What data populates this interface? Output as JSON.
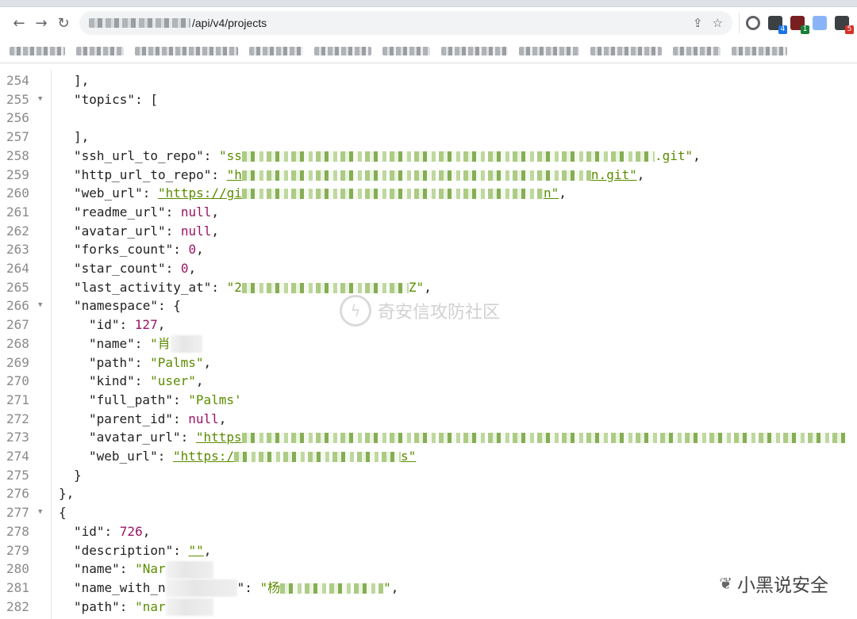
{
  "browser": {
    "url_path": "/api/v4/projects",
    "nav": {
      "back_icon": "←",
      "forward_icon": "→",
      "reload_icon": "↻"
    },
    "actions": {
      "share_icon": "⇪",
      "star_icon": "☆"
    },
    "extensions": [
      {
        "name": "circle-extension-icon",
        "color": "#5f6368",
        "badge": ""
      },
      {
        "name": "extension-icon-1",
        "color": "#3c4043",
        "badge": "4",
        "badge_color": "#1a73e8"
      },
      {
        "name": "extension-icon-2",
        "color": "#7a1f1f",
        "badge": "1",
        "badge_color": "#188038"
      },
      {
        "name": "hourglass-extension-icon",
        "color": "#8ab4f8",
        "badge": ""
      },
      {
        "name": "extension-icon-p",
        "color": "#3c4043",
        "badge": "5",
        "badge_color": "#d93025"
      }
    ]
  },
  "json_view": {
    "lines": [
      {
        "num": "254",
        "indent": 2,
        "text": "],"
      },
      {
        "num": "255",
        "indent": 2,
        "fold": "▼",
        "key": "topics",
        "open": "["
      },
      {
        "num": "256",
        "indent": 2,
        "text": ""
      },
      {
        "num": "257",
        "indent": 2,
        "text": "],"
      },
      {
        "num": "258",
        "indent": 2,
        "key": "ssh_url_to_repo",
        "str_pre": "ss",
        "mask": 520,
        "str_post": ".git",
        "trail": ","
      },
      {
        "num": "259",
        "indent": 2,
        "key": "http_url_to_repo",
        "url_pre": "h",
        "mask": 440,
        "url_post": "n.git",
        "trail": ","
      },
      {
        "num": "260",
        "indent": 2,
        "key": "web_url",
        "url_pre": "https://gi",
        "mask": 380,
        "url_post": "n",
        "trail": ","
      },
      {
        "num": "261",
        "indent": 2,
        "key": "readme_url",
        "null": "null",
        "trail": ","
      },
      {
        "num": "262",
        "indent": 2,
        "key": "avatar_url",
        "null": "null",
        "trail": ","
      },
      {
        "num": "263",
        "indent": 2,
        "key": "forks_count",
        "numval": "0",
        "trail": ","
      },
      {
        "num": "264",
        "indent": 2,
        "key": "star_count",
        "numval": "0",
        "trail": ","
      },
      {
        "num": "265",
        "indent": 2,
        "key": "last_activity_at",
        "str_pre": "2",
        "mask": 210,
        "str_post": "Z",
        "trail": ","
      },
      {
        "num": "266",
        "indent": 2,
        "fold": "▼",
        "key": "namespace",
        "open": "{"
      },
      {
        "num": "267",
        "indent": 3,
        "key": "id",
        "numval": "127",
        "trail": ","
      },
      {
        "num": "268",
        "indent": 3,
        "key": "name",
        "str_pre": "肖",
        "soft": 40,
        "str_post": "",
        "noclose": true
      },
      {
        "num": "269",
        "indent": 3,
        "key": "path",
        "str": "Palms",
        "trail": ","
      },
      {
        "num": "270",
        "indent": 3,
        "key": "kind",
        "str": "user",
        "trail": ","
      },
      {
        "num": "271",
        "indent": 3,
        "key": "full_path",
        "str_pre": "Palms",
        "str_post": "",
        "noclose": true,
        "quote_end": "'"
      },
      {
        "num": "272",
        "indent": 3,
        "key": "parent_id",
        "null": "null",
        "trail": ","
      },
      {
        "num": "273",
        "indent": 3,
        "key": "avatar_url",
        "url_pre": "https",
        "mask": 760,
        "url_post": "",
        "noclose": true
      },
      {
        "num": "274",
        "indent": 3,
        "key": "web_url",
        "url_pre": "https:/",
        "mask": 210,
        "url_post": "s",
        "trail": ""
      },
      {
        "num": "275",
        "indent": 2,
        "text": "}"
      },
      {
        "num": "276",
        "indent": 1,
        "text": "},"
      },
      {
        "num": "277",
        "indent": 1,
        "fold": "▼",
        "text": "{"
      },
      {
        "num": "278",
        "indent": 2,
        "key": "id",
        "numval": "726",
        "trail": ","
      },
      {
        "num": "279",
        "indent": 2,
        "key": "description",
        "str": "",
        "underline": true,
        "trail": ","
      },
      {
        "num": "280",
        "indent": 2,
        "key": "name",
        "str_pre": "Nar",
        "soft": 60,
        "str_post": "",
        "noclose": true
      },
      {
        "num": "281",
        "indent": 2,
        "key_pre": "name_with_n",
        "soft_key": 90,
        "str_pre": "杨",
        "mask": 130,
        "str_post": "",
        "trail": ","
      },
      {
        "num": "282",
        "indent": 2,
        "key": "path",
        "str_pre": "nar",
        "soft": 60,
        "str_post": "",
        "noclose": true
      }
    ]
  },
  "watermark": {
    "text": "奇安信攻防社区",
    "icon": "ϟ"
  },
  "signature": {
    "icon": "❦",
    "text": "小黑说安全"
  }
}
